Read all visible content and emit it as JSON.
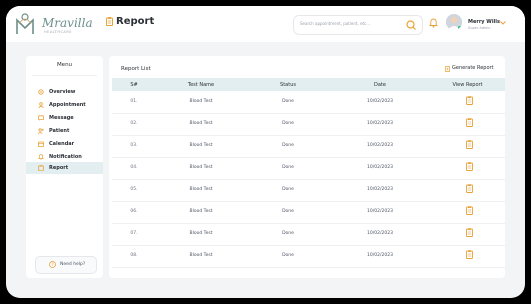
{
  "app": {
    "brand": "Mravilla",
    "brand_tagline": "HEALTHCARE",
    "page_title": "Report",
    "search_placeholder": "Search appointment, patient, etc...",
    "user_name": "Merry Wills",
    "user_role": "Super Admin"
  },
  "sidebar": {
    "title": "Menu",
    "items": [
      {
        "label": "Overview",
        "icon": "gear-icon"
      },
      {
        "label": "Appointment",
        "icon": "user-icon"
      },
      {
        "label": "Message",
        "icon": "message-icon"
      },
      {
        "label": "Patient",
        "icon": "patient-icon"
      },
      {
        "label": "Calendar",
        "icon": "calendar-icon"
      },
      {
        "label": "Notification",
        "icon": "bell-icon"
      },
      {
        "label": "Report",
        "icon": "clipboard-icon"
      }
    ],
    "help_label": "Need help?"
  },
  "report": {
    "title": "Report List",
    "generate_label": "Generate Report",
    "columns": [
      "S#",
      "Test Name",
      "Status",
      "Date",
      "View Report"
    ],
    "rows": [
      {
        "sn": "01.",
        "test": "Blood Test",
        "status": "Done",
        "date": "10/02/2023"
      },
      {
        "sn": "02.",
        "test": "Blood Test",
        "status": "Done",
        "date": "10/02/2023"
      },
      {
        "sn": "03.",
        "test": "Blood Test",
        "status": "Done",
        "date": "10/02/2023"
      },
      {
        "sn": "04.",
        "test": "Blood Test",
        "status": "Done",
        "date": "10/02/2023"
      },
      {
        "sn": "05.",
        "test": "Blood Test",
        "status": "Done",
        "date": "10/02/2023"
      },
      {
        "sn": "06.",
        "test": "Blood Test",
        "status": "Done",
        "date": "10/02/2023"
      },
      {
        "sn": "07.",
        "test": "Blood Test",
        "status": "Done",
        "date": "10/02/2023"
      },
      {
        "sn": "08.",
        "test": "Blood Test",
        "status": "Done",
        "date": "10/02/2023"
      }
    ]
  },
  "colors": {
    "accent": "#e8a23a",
    "header_row_bg": "#e3eef0",
    "active_bg": "#e3eef0"
  }
}
